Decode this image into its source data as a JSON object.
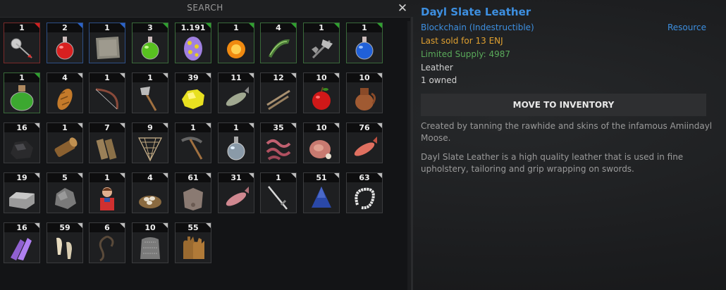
{
  "search": {
    "label": "SEARCH",
    "close_glyph": "✕"
  },
  "items": [
    {
      "qty": "1",
      "rarity": "red",
      "icon": "arrow-icon"
    },
    {
      "qty": "2",
      "rarity": "blue",
      "icon": "red-potion-icon"
    },
    {
      "qty": "1",
      "rarity": "blue",
      "icon": "parchment-icon"
    },
    {
      "qty": "3",
      "rarity": "green",
      "icon": "green-potion-icon"
    },
    {
      "qty": "1.191",
      "rarity": "green",
      "icon": "egg-icon"
    },
    {
      "qty": "1",
      "rarity": "green",
      "icon": "orange-potion-icon"
    },
    {
      "qty": "4",
      "rarity": "green",
      "icon": "green-scroll-icon"
    },
    {
      "qty": "1",
      "rarity": "green",
      "icon": "battle-axe-icon"
    },
    {
      "qty": "1",
      "rarity": "green",
      "icon": "blue-potion-icon"
    },
    {
      "qty": "1",
      "rarity": "green",
      "icon": "large-green-potion-icon"
    },
    {
      "qty": "4",
      "rarity": "normal",
      "icon": "bread-icon"
    },
    {
      "qty": "1",
      "rarity": "normal",
      "icon": "bow-icon"
    },
    {
      "qty": "1",
      "rarity": "normal",
      "icon": "hatchet-icon"
    },
    {
      "qty": "39",
      "rarity": "normal",
      "icon": "sulfur-icon"
    },
    {
      "qty": "11",
      "rarity": "normal",
      "icon": "fish-icon"
    },
    {
      "qty": "12",
      "rarity": "normal",
      "icon": "sticks-icon"
    },
    {
      "qty": "10",
      "rarity": "normal",
      "icon": "apple-icon"
    },
    {
      "qty": "10",
      "rarity": "normal",
      "icon": "clay-jug-icon"
    },
    {
      "qty": "16",
      "rarity": "normal",
      "icon": "coal-icon"
    },
    {
      "qty": "1",
      "rarity": "normal",
      "icon": "log-icon"
    },
    {
      "qty": "7",
      "rarity": "normal",
      "icon": "planks-icon"
    },
    {
      "qty": "9",
      "rarity": "normal",
      "icon": "net-icon"
    },
    {
      "qty": "1",
      "rarity": "normal",
      "icon": "pickaxe-icon"
    },
    {
      "qty": "1",
      "rarity": "normal",
      "icon": "empty-flask-icon"
    },
    {
      "qty": "35",
      "rarity": "normal",
      "icon": "worms-icon"
    },
    {
      "qty": "10",
      "rarity": "normal",
      "icon": "ham-icon"
    },
    {
      "qty": "76",
      "rarity": "normal",
      "icon": "red-fish-icon"
    },
    {
      "qty": "19",
      "rarity": "normal",
      "icon": "iron-ingot-icon"
    },
    {
      "qty": "5",
      "rarity": "normal",
      "icon": "stone-icon"
    },
    {
      "qty": "1",
      "rarity": "normal",
      "icon": "character-icon"
    },
    {
      "qty": "4",
      "rarity": "normal",
      "icon": "bird-nest-icon"
    },
    {
      "qty": "61",
      "rarity": "normal",
      "icon": "leather-hide-icon"
    },
    {
      "qty": "31",
      "rarity": "normal",
      "icon": "raw-fish-icon"
    },
    {
      "qty": "1",
      "rarity": "normal",
      "icon": "sword-icon"
    },
    {
      "qty": "51",
      "rarity": "normal",
      "icon": "blue-cloth-icon"
    },
    {
      "qty": "63",
      "rarity": "normal",
      "icon": "pearl-string-icon"
    },
    {
      "qty": "16",
      "rarity": "normal",
      "icon": "crystal-icon"
    },
    {
      "qty": "59",
      "rarity": "normal",
      "icon": "teeth-icon"
    },
    {
      "qty": "6",
      "rarity": "normal",
      "icon": "rope-icon"
    },
    {
      "qty": "10",
      "rarity": "normal",
      "icon": "chainmail-icon"
    },
    {
      "qty": "55",
      "rarity": "normal",
      "icon": "gloves-icon"
    }
  ],
  "detail": {
    "title": "Dayl Slate Leather",
    "chain": "Blockchain (Indestructible)",
    "category": "Resource",
    "last_sold": "Last sold for 13 ENJ",
    "supply": "Limited Supply: 4987",
    "type": "Leather",
    "owned": "1 owned",
    "move_button": "MOVE TO INVENTORY",
    "desc1": "Created by tanning the rawhide and skins of the infamous Amiindayl Moose.",
    "desc2": "Dayl Slate Leather is a high quality leather that is used in fine upholstery, tailoring and grip wrapping on swords."
  },
  "colors": {
    "title": "#3d8fe0",
    "last_sold": "#e0a030",
    "supply": "#5aaa5a",
    "rarity_red": "#d02020",
    "rarity_blue": "#2b62c8",
    "rarity_green": "#2fa02f"
  }
}
